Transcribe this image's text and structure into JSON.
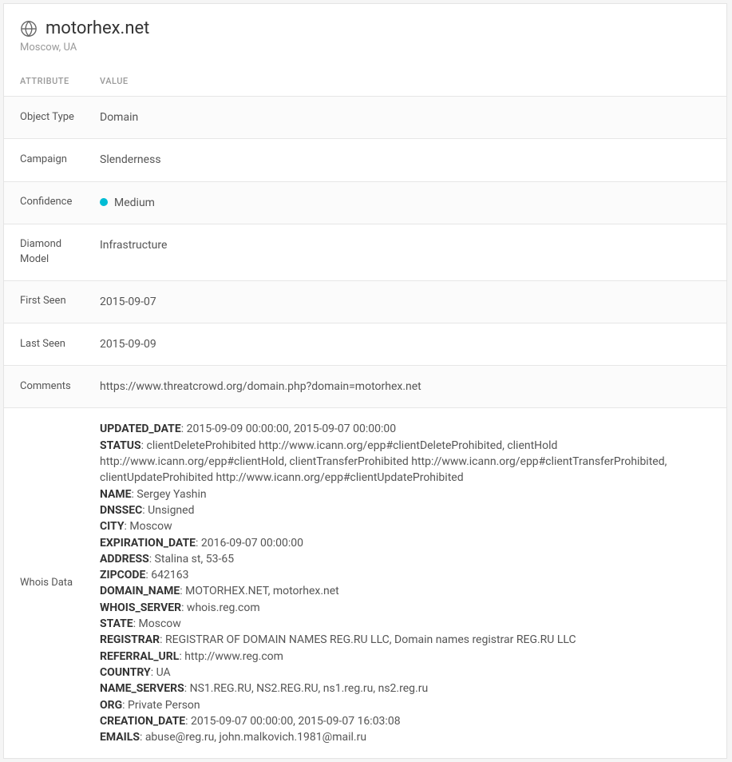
{
  "header": {
    "title": "motorhex.net",
    "subtitle": "Moscow, UA"
  },
  "columns": {
    "attribute": "ATTRIBUTE",
    "value": "VALUE"
  },
  "rows": {
    "object_type": {
      "label": "Object Type",
      "value": "Domain"
    },
    "campaign": {
      "label": "Campaign",
      "value": "Slenderness"
    },
    "confidence": {
      "label": "Confidence",
      "value": "Medium",
      "dot_color": "#00bcd4"
    },
    "diamond_model": {
      "label": "Diamond Model",
      "value": "Infrastructure"
    },
    "first_seen": {
      "label": "First Seen",
      "value": "2015-09-07"
    },
    "last_seen": {
      "label": "Last Seen",
      "value": "2015-09-09"
    },
    "comments": {
      "label": "Comments",
      "value": "https://www.threatcrowd.org/domain.php?domain=motorhex.net"
    },
    "whois": {
      "label": "Whois Data",
      "lines": [
        {
          "key": "UPDATED_DATE",
          "value": "2015-09-09 00:00:00, 2015-09-07 00:00:00"
        },
        {
          "key": "STATUS",
          "value": "clientDeleteProhibited http://www.icann.org/epp#clientDeleteProhibited, clientHold http://www.icann.org/epp#clientHold, clientTransferProhibited http://www.icann.org/epp#clientTransferProhibited, clientUpdateProhibited http://www.icann.org/epp#clientUpdateProhibited"
        },
        {
          "key": "NAME",
          "value": "Sergey Yashin"
        },
        {
          "key": "DNSSEC",
          "value": "Unsigned"
        },
        {
          "key": "CITY",
          "value": "Moscow"
        },
        {
          "key": "EXPIRATION_DATE",
          "value": "2016-09-07 00:00:00"
        },
        {
          "key": "ADDRESS",
          "value": "Stalina st, 53-65"
        },
        {
          "key": "ZIPCODE",
          "value": "642163"
        },
        {
          "key": "DOMAIN_NAME",
          "value": "MOTORHEX.NET, motorhex.net"
        },
        {
          "key": "WHOIS_SERVER",
          "value": "whois.reg.com"
        },
        {
          "key": "STATE",
          "value": "Moscow"
        },
        {
          "key": "REGISTRAR",
          "value": "REGISTRAR OF DOMAIN NAMES REG.RU LLC, Domain names registrar REG.RU LLC"
        },
        {
          "key": "REFERRAL_URL",
          "value": "http://www.reg.com"
        },
        {
          "key": "COUNTRY",
          "value": "UA"
        },
        {
          "key": "NAME_SERVERS",
          "value": "NS1.REG.RU, NS2.REG.RU, ns1.reg.ru, ns2.reg.ru"
        },
        {
          "key": "ORG",
          "value": "Private Person"
        },
        {
          "key": "CREATION_DATE",
          "value": "2015-09-07 00:00:00, 2015-09-07 16:03:08"
        },
        {
          "key": "EMAILS",
          "value": "abuse@reg.ru, john.malkovich.1981@mail.ru"
        }
      ]
    }
  }
}
